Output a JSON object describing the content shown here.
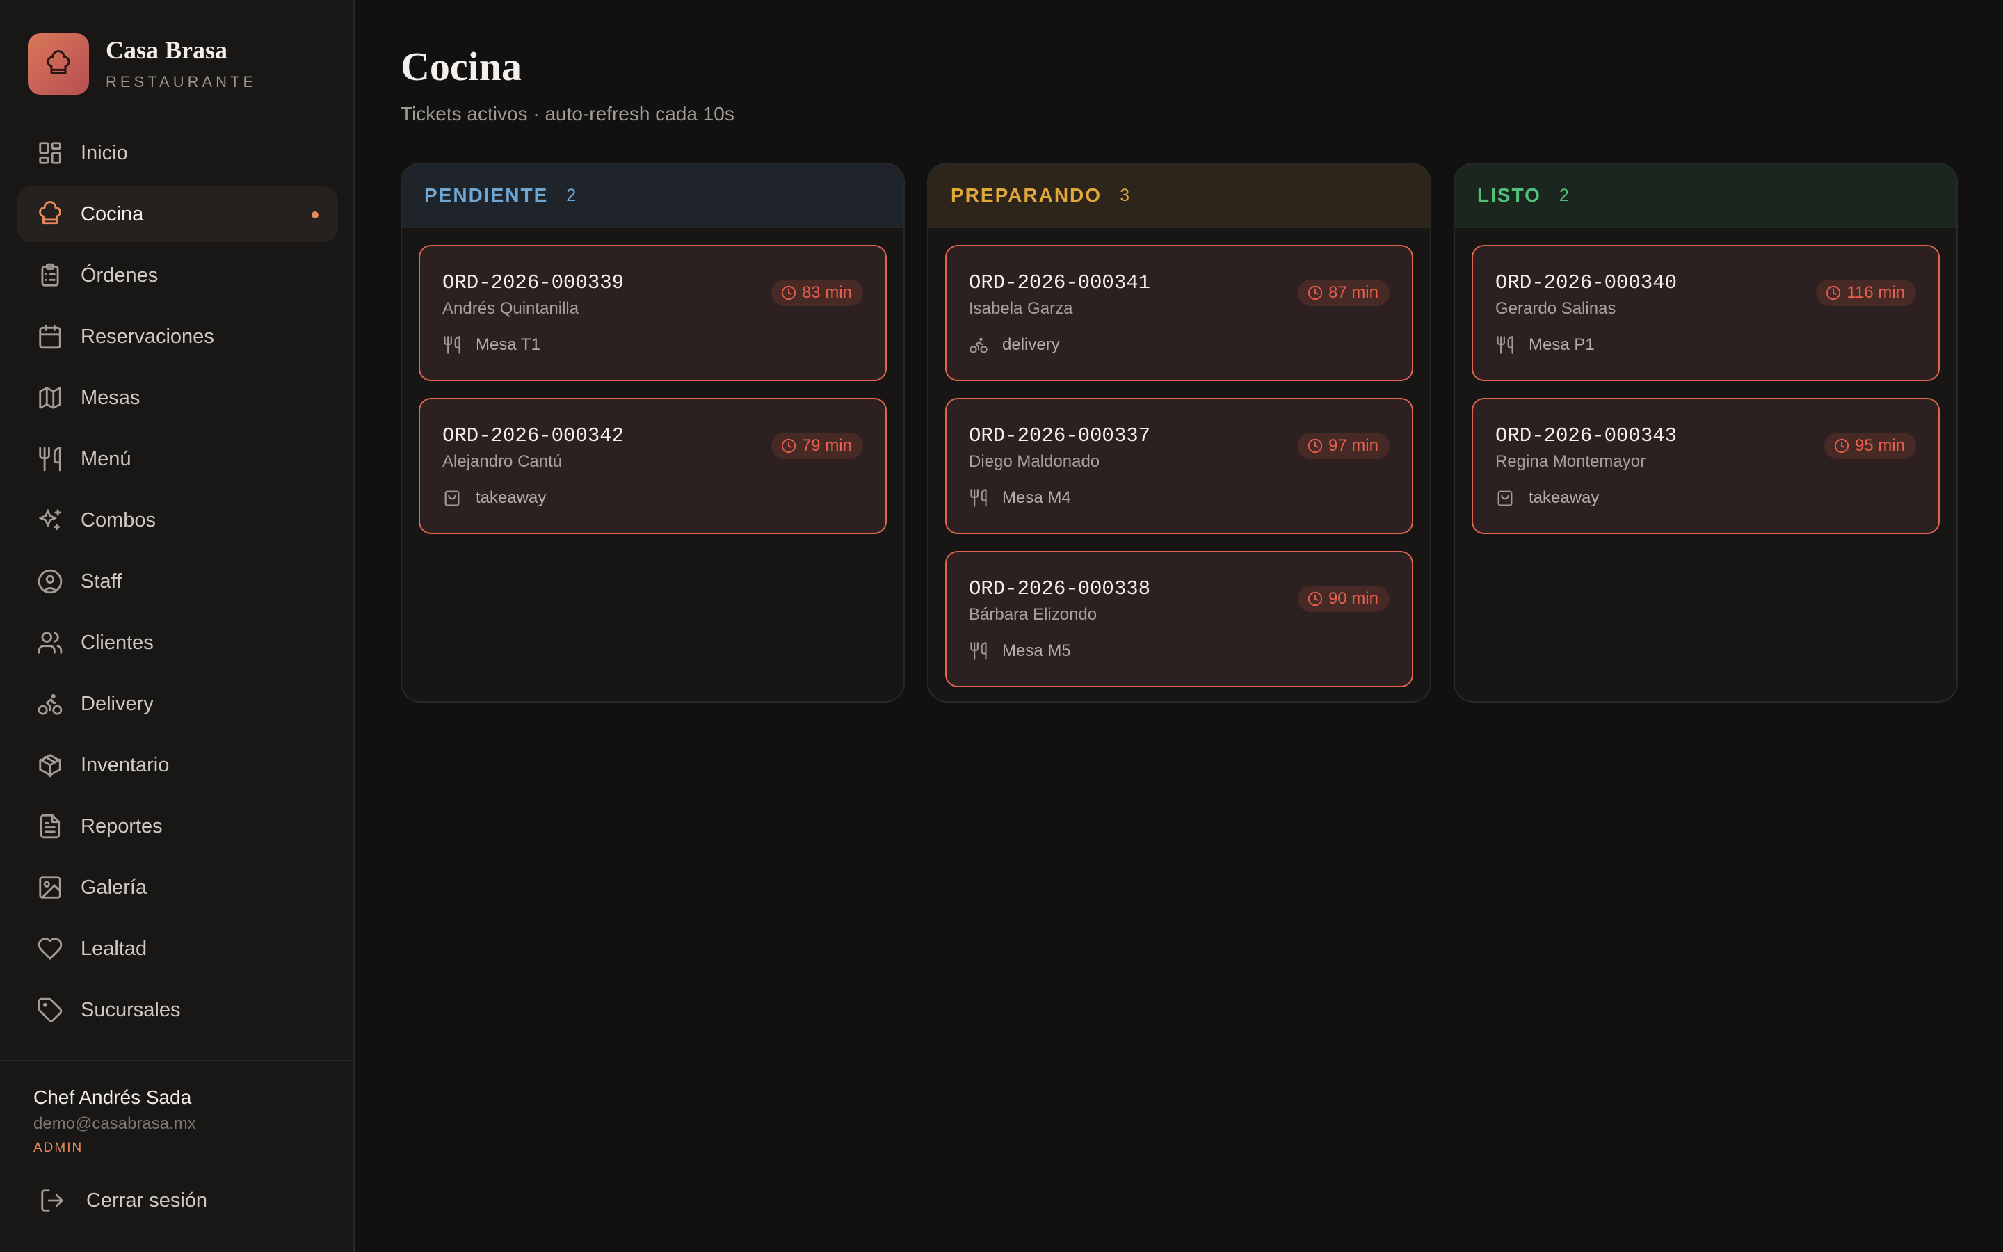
{
  "brand": {
    "name": "Casa Brasa",
    "subtitle": "RESTAURANTE"
  },
  "nav": [
    {
      "label": "Inicio",
      "icon": "grid-icon"
    },
    {
      "label": "Cocina",
      "icon": "chef-hat-icon",
      "active": true
    },
    {
      "label": "Órdenes",
      "icon": "clipboard-icon"
    },
    {
      "label": "Reservaciones",
      "icon": "calendar-icon"
    },
    {
      "label": "Mesas",
      "icon": "map-icon"
    },
    {
      "label": "Menú",
      "icon": "utensils-icon"
    },
    {
      "label": "Combos",
      "icon": "sparkles-icon"
    },
    {
      "label": "Staff",
      "icon": "user-circle-icon"
    },
    {
      "label": "Clientes",
      "icon": "users-icon"
    },
    {
      "label": "Delivery",
      "icon": "bike-icon"
    },
    {
      "label": "Inventario",
      "icon": "package-icon"
    },
    {
      "label": "Reportes",
      "icon": "file-text-icon"
    },
    {
      "label": "Galería",
      "icon": "image-icon"
    },
    {
      "label": "Lealtad",
      "icon": "heart-icon"
    },
    {
      "label": "Sucursales",
      "icon": "tag-icon"
    }
  ],
  "user": {
    "name": "Chef Andrés Sada",
    "email": "demo@casabrasa.mx",
    "role": "ADMIN"
  },
  "logout_label": "Cerrar sesión",
  "page": {
    "title": "Cocina",
    "subtitle": "Tickets activos · auto-refresh cada 10s"
  },
  "colors": {
    "accent": "#e8895c",
    "pendiente": "#6ea6d6",
    "preparando": "#e0a73c",
    "listo": "#4fbf7a",
    "ticket_border": "#e0644f",
    "timer": "#e8604d"
  },
  "columns": [
    {
      "title": "PENDIENTE",
      "count": "2",
      "tickets": [
        {
          "id": "ORD-2026-000339",
          "client": "Andrés Quintanilla",
          "time": "83 min",
          "meta": "Mesa T1",
          "meta_icon": "utensils-icon"
        },
        {
          "id": "ORD-2026-000342",
          "client": "Alejandro Cantú",
          "time": "79 min",
          "meta": "takeaway",
          "meta_icon": "bag-icon"
        }
      ]
    },
    {
      "title": "PREPARANDO",
      "count": "3",
      "tickets": [
        {
          "id": "ORD-2026-000341",
          "client": "Isabela Garza",
          "time": "87 min",
          "meta": "delivery",
          "meta_icon": "bike-icon"
        },
        {
          "id": "ORD-2026-000337",
          "client": "Diego Maldonado",
          "time": "97 min",
          "meta": "Mesa M4",
          "meta_icon": "utensils-icon"
        },
        {
          "id": "ORD-2026-000338",
          "client": "Bárbara Elizondo",
          "time": "90 min",
          "meta": "Mesa M5",
          "meta_icon": "utensils-icon"
        }
      ]
    },
    {
      "title": "LISTO",
      "count": "2",
      "tickets": [
        {
          "id": "ORD-2026-000340",
          "client": "Gerardo Salinas",
          "time": "116 min",
          "meta": "Mesa P1",
          "meta_icon": "utensils-icon"
        },
        {
          "id": "ORD-2026-000343",
          "client": "Regina Montemayor",
          "time": "95 min",
          "meta": "takeaway",
          "meta_icon": "bag-icon"
        }
      ]
    }
  ]
}
